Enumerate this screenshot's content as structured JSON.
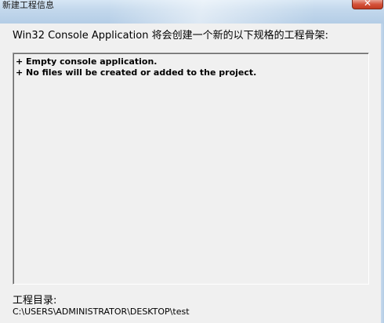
{
  "window": {
    "title": "新建工程信息",
    "close_icon": "close-icon",
    "close_glyph": "✕"
  },
  "dialog": {
    "heading": "Win32 Console Application 将会创建一个新的以下规格的工程骨架:",
    "summary_lines": [
      "+ Empty console application.",
      "+ No files will be created or added to the project."
    ],
    "directory_label": "工程目录:",
    "directory_path": "C:\\USERS\\ADMINISTRATOR\\DESKTOP\\test"
  },
  "colors": {
    "titlebar": "#c3d8ec",
    "client_background": "#f0f0f0",
    "close_button": "#d4523a"
  }
}
